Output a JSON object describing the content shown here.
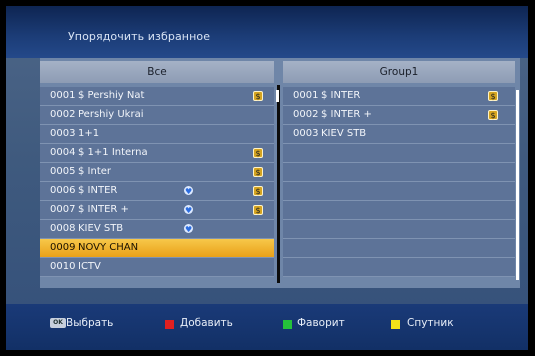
{
  "header": {
    "title": "Упорядочить избранное"
  },
  "left_panel": {
    "header": "Все",
    "rows": [
      {
        "num": "0001",
        "name": "$ Pershiy Nat",
        "scrambled": true,
        "fav": false,
        "selected": false
      },
      {
        "num": "0002",
        "name": "Pershiy Ukrai",
        "scrambled": false,
        "fav": false,
        "selected": false
      },
      {
        "num": "0003",
        "name": "1+1",
        "scrambled": false,
        "fav": false,
        "selected": false
      },
      {
        "num": "0004",
        "name": "$ 1+1 Interna",
        "scrambled": true,
        "fav": false,
        "selected": false
      },
      {
        "num": "0005",
        "name": "$ Inter",
        "scrambled": true,
        "fav": false,
        "selected": false
      },
      {
        "num": "0006",
        "name": "$ INTER",
        "scrambled": true,
        "fav": true,
        "selected": false
      },
      {
        "num": "0007",
        "name": "$ INTER +",
        "scrambled": true,
        "fav": true,
        "selected": false
      },
      {
        "num": "0008",
        "name": "KIEV STB",
        "scrambled": false,
        "fav": true,
        "selected": false
      },
      {
        "num": "0009",
        "name": "NOVY CHAN",
        "scrambled": false,
        "fav": false,
        "selected": true
      },
      {
        "num": "0010",
        "name": "ICTV",
        "scrambled": false,
        "fav": false,
        "selected": false
      }
    ]
  },
  "right_panel": {
    "header": "Group1",
    "rows": [
      {
        "num": "0001",
        "name": "$ INTER",
        "scrambled": true
      },
      {
        "num": "0002",
        "name": "$ INTER +",
        "scrambled": true
      },
      {
        "num": "0003",
        "name": "KIEV STB",
        "scrambled": false
      },
      {
        "num": "",
        "name": "",
        "scrambled": false
      },
      {
        "num": "",
        "name": "",
        "scrambled": false
      },
      {
        "num": "",
        "name": "",
        "scrambled": false
      },
      {
        "num": "",
        "name": "",
        "scrambled": false
      },
      {
        "num": "",
        "name": "",
        "scrambled": false
      },
      {
        "num": "",
        "name": "",
        "scrambled": false
      },
      {
        "num": "",
        "name": "",
        "scrambled": false
      }
    ]
  },
  "footer": {
    "ok_key_label": "OK",
    "select": "Выбрать",
    "add": "Добавить",
    "favorite": "Фаворит",
    "satellite": "Спутник"
  },
  "colors": {
    "red_key": "#e02020",
    "green_key": "#25c23a",
    "yellow_key": "#f2e21a",
    "highlight": "#f0b030"
  }
}
